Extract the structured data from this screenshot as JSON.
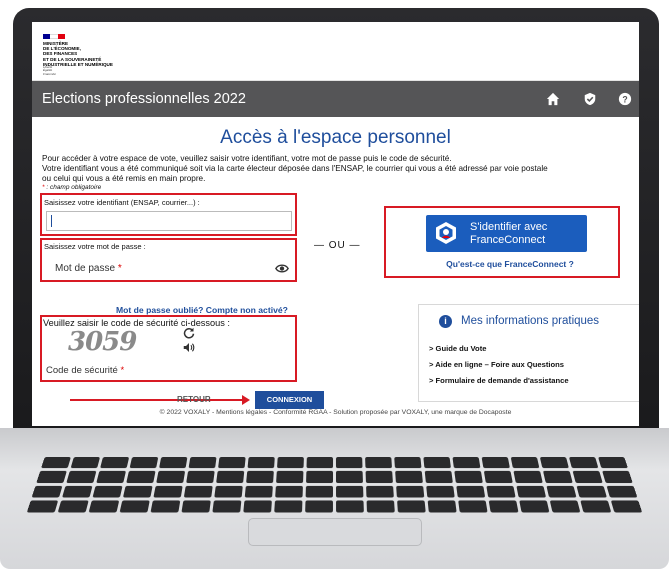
{
  "gov": {
    "ministry_lines": [
      "MINISTÈRE",
      "DE L'ÉCONOMIE,",
      "DES FINANCES",
      "ET DE LA SOUVERAINETÉ",
      "INDUSTRIELLE ET NUMÉRIQUE"
    ],
    "motto": [
      "Liberté",
      "Égalité",
      "Fraternité"
    ],
    "flag_colors": [
      "#000091",
      "#ffffff",
      "#e1000f"
    ]
  },
  "appbar": {
    "title": "Elections professionnelles 2022",
    "icons": [
      "home-icon",
      "shield-check-icon",
      "help-icon"
    ]
  },
  "main": {
    "page_title": "Accès à l'espace personnel",
    "intro_lines": [
      "Pour accéder à votre espace de vote, veuillez saisir votre identifiant, votre mot de passe puis le code de sécurité.",
      "Votre identifiant vous a été communiqué soit via la carte électeur déposée dans l'ENSAP, le courrier qui vous a été adressé par voie postale",
      "ou celui qui vous a été remis en main propre."
    ],
    "mandatory_note": ": champ obligatoire",
    "identifier_label": "Saisissez votre identifiant (ENSAP, courrier...) :",
    "identifier_value": "",
    "password_label": "Saisissez votre mot de passe :",
    "password_placeholder": "Mot de passe",
    "forgot_link": "Mot de passe oublié? Compte non activé?",
    "captcha_label": "Veuillez saisir le code de sécurité ci-dessous :",
    "captcha_text": "3059",
    "security_placeholder": "Code de sécurité",
    "separator": "— OU —",
    "retour_label": "RETOUR",
    "connexion_label": "CONNEXION"
  },
  "franceconnect": {
    "button_line1": "S'identifier avec",
    "button_line2": "FranceConnect",
    "link": "Qu'est-ce que FranceConnect ?"
  },
  "info": {
    "title": "Mes informations pratiques",
    "items": [
      "> Guide du Vote",
      "> Aide en ligne – Foire aux Questions",
      "> Formulaire de demande d'assistance"
    ]
  },
  "footer": {
    "text": "© 2022 VOXALY - Mentions légales - Conformité RGAA - Solution proposée par VOXALY, une marque de Docaposte"
  },
  "colors": {
    "accent": "#1f4e9c",
    "highlight": "#d81a24",
    "appbar": "#555557",
    "franceconnect": "#1b5dbd"
  }
}
